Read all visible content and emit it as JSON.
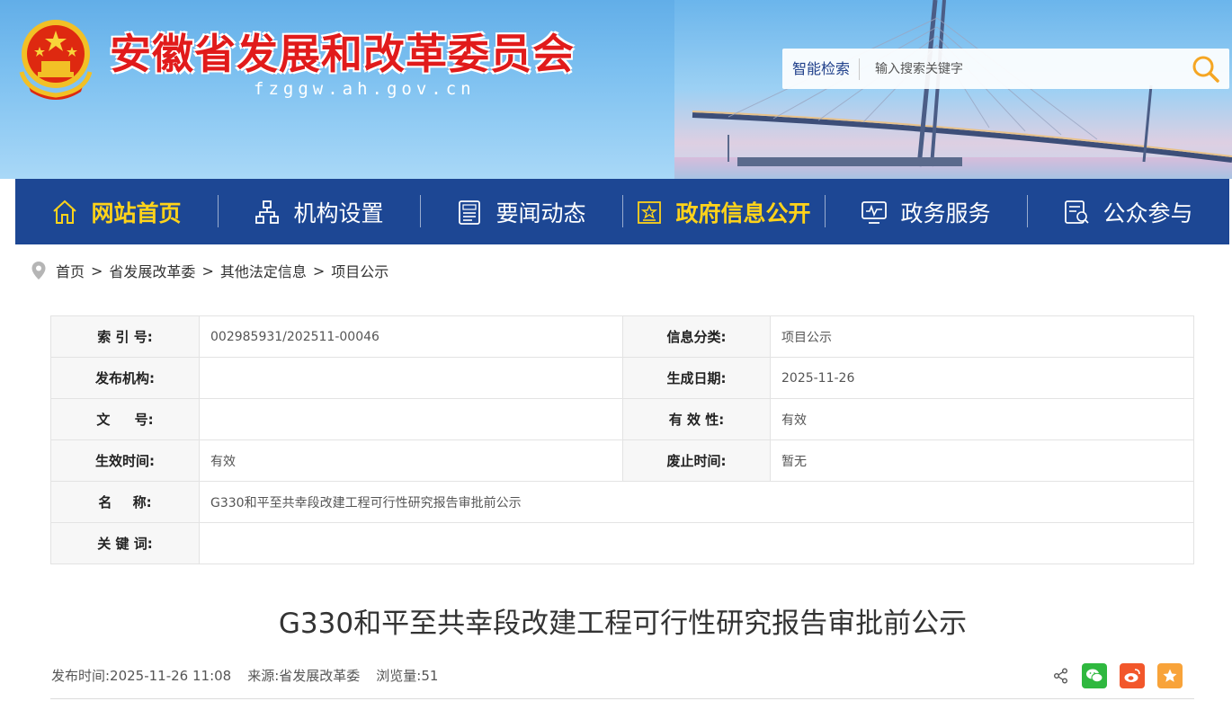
{
  "header": {
    "title": "安徽省发展和改革委员会",
    "domain": "fzggw.ah.gov.cn",
    "search_label": "智能检索",
    "search_placeholder": "输入搜索关键字"
  },
  "nav": {
    "items": [
      {
        "label": "网站首页",
        "icon": "home-icon",
        "active": true
      },
      {
        "label": "机构设置",
        "icon": "org-chart-icon",
        "active": false
      },
      {
        "label": "要闻动态",
        "icon": "news-icon",
        "active": false
      },
      {
        "label": "政府信息公开",
        "icon": "info-disclosure-icon",
        "active": true
      },
      {
        "label": "政务服务",
        "icon": "monitor-icon",
        "active": false
      },
      {
        "label": "公众参与",
        "icon": "participation-icon",
        "active": false
      }
    ]
  },
  "breadcrumb": [
    "首页",
    "省发展改革委",
    "其他法定信息",
    "项目公示"
  ],
  "breadcrumb_sep": ">",
  "info": {
    "index_label": "索 引 号:",
    "index_value": "002985931/202511-00046",
    "category_label": "信息分类:",
    "category_value": "项目公示",
    "publisher_label": "发布机构:",
    "publisher_value": "",
    "created_label": "生成日期:",
    "created_value": "2025-11-26",
    "docno_label": "文 号:",
    "docno_value": "",
    "validity_label": "有 效 性:",
    "validity_value": "有效",
    "effective_label": "生效时间:",
    "effective_value": "有效",
    "abolish_label": "废止时间:",
    "abolish_value": "暂无",
    "name_label": "名 称:",
    "name_value": "G330和平至共幸段改建工程可行性研究报告审批前公示",
    "keywords_label": "关 键 词:",
    "keywords_value": ""
  },
  "article": {
    "title": "G330和平至共幸段改建工程可行性研究报告审批前公示",
    "publish_time": "发布时间:2025-11-26 11:08",
    "source": "来源:省发展改革委",
    "views": "浏览量:51"
  },
  "colors": {
    "nav_bg": "#1d4794",
    "nav_active": "#ffd31a",
    "title_red": "#e11b1b",
    "wechat": "#2fb83f",
    "weibo": "#f2572b",
    "favorite": "#f8a33a"
  }
}
